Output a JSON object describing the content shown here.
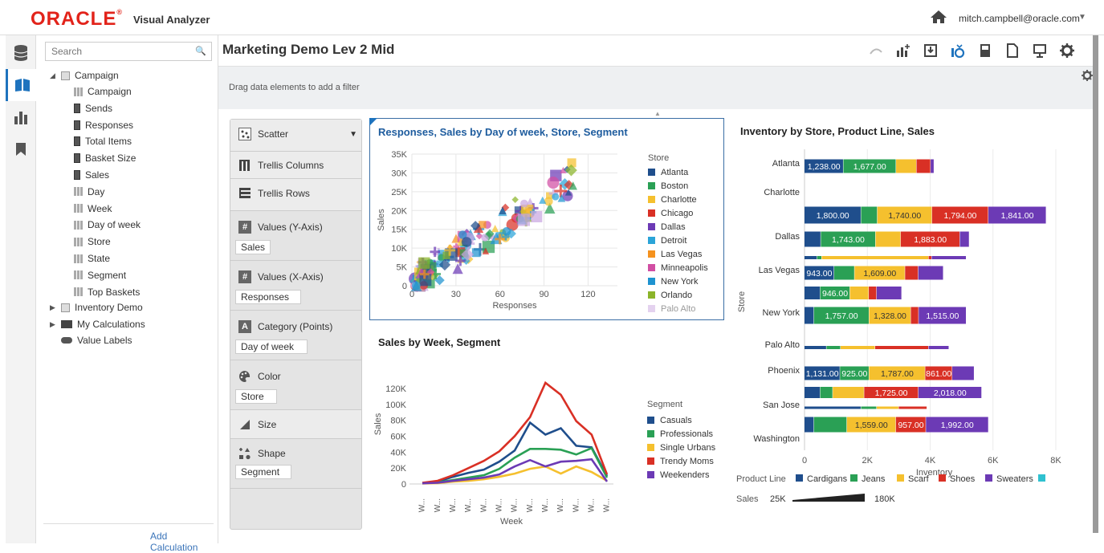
{
  "header": {
    "logo": "ORACLE",
    "product": "Visual Analyzer",
    "user": "mitch.campbell@oracle.com"
  },
  "search": {
    "placeholder": "Search"
  },
  "tree": {
    "root": "Campaign",
    "items": [
      "Campaign",
      "Sends",
      "Responses",
      "Total Items",
      "Basket Size",
      "Sales",
      "Day",
      "Week",
      "Day of week",
      "Store",
      "State",
      "Segment",
      "Top Baskets"
    ],
    "inventory": "Inventory Demo",
    "my_calc": "My Calculations",
    "value_labels": "Value Labels"
  },
  "add_calc": "Add Calculation",
  "project_title": "Marketing Demo Lev 2 Mid",
  "filter_hint": "Drag data elements to add a filter",
  "grammar": {
    "viz_type": "Scatter",
    "trellis_columns": "Trellis Columns",
    "trellis_rows": "Trellis Rows",
    "values_y": "Values (Y-Axis)",
    "values_y_val": "Sales",
    "values_x": "Values (X-Axis)",
    "values_x_val": "Responses",
    "category": "Category (Points)",
    "category_val": "Day of week",
    "color": "Color",
    "color_val": "Store",
    "size": "Size",
    "shape": "Shape",
    "shape_val": "Segment"
  },
  "colors": {
    "Atlanta": "#1f4e8c",
    "Boston": "#2aa055",
    "Charlotte": "#f5c02e",
    "Chicago": "#d93025",
    "Dallas": "#6c3ab5",
    "Detroit": "#2ba4d8",
    "Las Vegas": "#f5921e",
    "Minneapolis": "#d14ea3",
    "New York": "#1e93d0",
    "Orlando": "#8bb42a",
    "Palo Alto": "#c9a6e0"
  },
  "chart_data": [
    {
      "type": "scatter",
      "title": "Responses, Sales by Day of week, Store, Segment",
      "xlabel": "Responses",
      "ylabel": "Sales",
      "xlim": [
        0,
        140
      ],
      "ylim": [
        0,
        35000
      ],
      "xticks": [
        "0",
        "30",
        "60",
        "90",
        "120"
      ],
      "yticks": [
        "0",
        "5K",
        "10K",
        "15K",
        "20K",
        "25K",
        "30K",
        "35K"
      ],
      "legend_title": "Store",
      "legend": [
        "Atlanta",
        "Boston",
        "Charlotte",
        "Chicago",
        "Dallas",
        "Detroit",
        "Las Vegas",
        "Minneapolis",
        "New York",
        "Orlando",
        "Palo Alto"
      ]
    },
    {
      "type": "line",
      "title": "Sales by Week, Segment",
      "xlabel": "Week",
      "ylabel": "Sales",
      "ylim": [
        0,
        130000
      ],
      "yticks": [
        "0",
        "20K",
        "40K",
        "60K",
        "80K",
        "100K",
        "120K"
      ],
      "xticklabel": "W...",
      "legend_title": "Segment",
      "series": [
        {
          "name": "Casuals",
          "color": "#1f4e8c",
          "values": [
            1000,
            3000,
            9000,
            14000,
            18000,
            28000,
            42000,
            77000,
            62000,
            70000,
            48000,
            46000,
            10000
          ]
        },
        {
          "name": "Professionals",
          "color": "#2aa055",
          "values": [
            1000,
            2000,
            5000,
            8000,
            11000,
            19000,
            33000,
            44000,
            44000,
            43000,
            37000,
            45000,
            8000
          ]
        },
        {
          "name": "Single Urbans",
          "color": "#f5c02e",
          "values": [
            500,
            1000,
            3000,
            4000,
            6000,
            9000,
            13000,
            19000,
            22000,
            13000,
            22000,
            15000,
            4000
          ]
        },
        {
          "name": "Trendy Moms",
          "color": "#d93025",
          "values": [
            1500,
            4000,
            11000,
            20000,
            29000,
            41000,
            60000,
            84000,
            127000,
            112000,
            79000,
            62000,
            12000
          ]
        },
        {
          "name": "Weekenders",
          "color": "#6c3ab5",
          "values": [
            800,
            1500,
            4000,
            6000,
            8000,
            12000,
            22000,
            30000,
            22000,
            28000,
            29000,
            31000,
            3000
          ]
        }
      ]
    },
    {
      "type": "bar",
      "title": "Inventory by Store, Product Line, Sales",
      "xlabel": "Inventory",
      "ylabel": "Store",
      "xlim": [
        0,
        8000
      ],
      "xticks": [
        "0",
        "2K",
        "4K",
        "6K",
        "8K"
      ],
      "categories": [
        "Atlanta",
        "Charlotte",
        "Dallas",
        "Las Vegas",
        "New York",
        "Palo Alto",
        "Phoenix",
        "San Jose",
        "Washington"
      ],
      "legend_title": "Product Line",
      "legend": [
        {
          "name": "Cardigans",
          "color": "#1f4e8c"
        },
        {
          "name": "Jeans",
          "color": "#2aa055"
        },
        {
          "name": "Scarf",
          "color": "#f5c02e"
        },
        {
          "name": "Shoes",
          "color": "#d93025"
        },
        {
          "name": "Sweaters",
          "color": "#6c3ab5"
        }
      ],
      "size_legend": {
        "label": "Sales",
        "min": "25K",
        "max": "180K"
      },
      "bars": [
        {
          "row": 0,
          "segs": [
            [
              1238,
              "1,238.00"
            ],
            [
              1677,
              "1,677.00"
            ],
            [
              650,
              ""
            ],
            [
              450,
              ""
            ],
            [
              110,
              ""
            ]
          ]
        },
        {
          "row": 1,
          "segs": [
            [
              1800,
              "1,800.00"
            ],
            [
              520,
              ""
            ],
            [
              1740,
              "1,740.00"
            ],
            [
              1794,
              "1,794.00"
            ],
            [
              1841,
              "1,841.00"
            ]
          ]
        },
        {
          "row": 2,
          "segs": [
            [
              520,
              ""
            ],
            [
              1743,
              "1,743.00"
            ],
            [
              800,
              ""
            ],
            [
              1883,
              "1,883.00"
            ],
            [
              300,
              ""
            ]
          ]
        },
        {
          "row": 3,
          "segs": [
            [
              400,
              ""
            ],
            [
              150,
              ""
            ],
            [
              3400,
              ""
            ],
            [
              100,
              ""
            ],
            [
              1100,
              ""
            ]
          ]
        },
        {
          "row": 4,
          "segs": [
            [
              943,
              "943.00"
            ],
            [
              650,
              ""
            ],
            [
              1609,
              "1,609.00"
            ],
            [
              420,
              ""
            ],
            [
              800,
              ""
            ]
          ]
        },
        {
          "row": 5,
          "segs": [
            [
              500,
              ""
            ],
            [
              946,
              "946.00"
            ],
            [
              600,
              ""
            ],
            [
              250,
              ""
            ],
            [
              800,
              ""
            ]
          ]
        },
        {
          "row": 6,
          "segs": [
            [
              300,
              ""
            ],
            [
              1757,
              "1,757.00"
            ],
            [
              1328,
              "1,328.00"
            ],
            [
              250,
              ""
            ],
            [
              1515,
              "1,515.00"
            ]
          ]
        },
        {
          "row": 7,
          "segs": [
            [
              700,
              ""
            ],
            [
              450,
              ""
            ],
            [
              1100,
              ""
            ],
            [
              1700,
              ""
            ],
            [
              650,
              ""
            ]
          ]
        },
        {
          "row": 8,
          "segs": [
            [
              1131,
              "1,131.00"
            ],
            [
              925,
              "925.00"
            ],
            [
              1787,
              "1,787.00"
            ],
            [
              861,
              "861.00"
            ],
            [
              700,
              ""
            ]
          ]
        },
        {
          "row": 9,
          "segs": [
            [
              500,
              ""
            ],
            [
              400,
              ""
            ],
            [
              1000,
              ""
            ],
            [
              1725,
              "1,725.00"
            ],
            [
              2018,
              "2,018.00"
            ]
          ]
        },
        {
          "row": 10,
          "segs": [
            [
              1800,
              ""
            ],
            [
              500,
              ""
            ],
            [
              700,
              ""
            ],
            [
              900,
              ""
            ],
            [
              0,
              ""
            ]
          ]
        },
        {
          "row": 11,
          "segs": [
            [
              300,
              ""
            ],
            [
              1050,
              ""
            ],
            [
              1559,
              "1,559.00"
            ],
            [
              957,
              "957.00"
            ],
            [
              1992,
              "1,992.00"
            ]
          ]
        }
      ]
    }
  ]
}
